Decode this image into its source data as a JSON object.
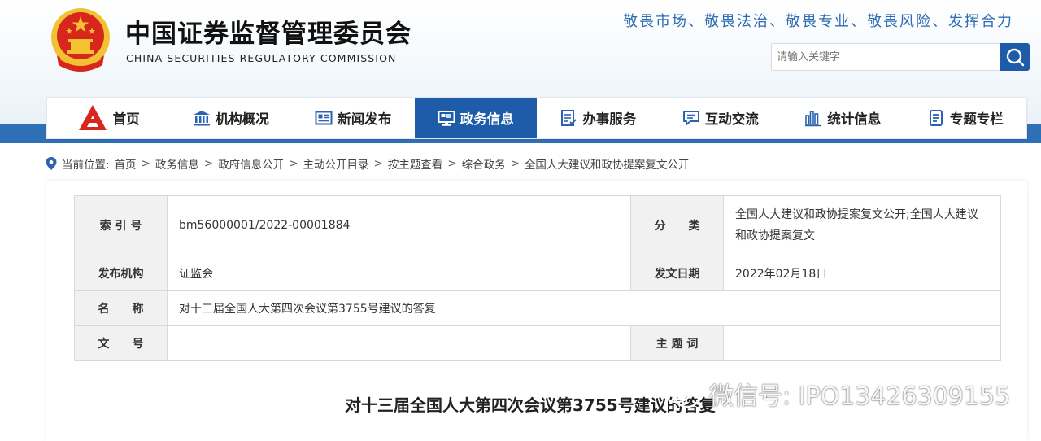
{
  "header": {
    "title_cn": "中国证券监督管理委员会",
    "title_en": "CHINA SECURITIES REGULATORY COMMISSION",
    "slogan": "敬畏市场、敬畏法治、敬畏专业、敬畏风险、发挥合力",
    "search_placeholder": "请输入关键字",
    "emblem_icon": "national-emblem-icon",
    "search_icon": "search-icon"
  },
  "nav": {
    "items": [
      {
        "label": "首页",
        "icon": "home-logo-icon",
        "active": false
      },
      {
        "label": "机构概况",
        "icon": "building-icon",
        "active": false
      },
      {
        "label": "新闻发布",
        "icon": "newspaper-icon",
        "active": false
      },
      {
        "label": "政务信息",
        "icon": "monitor-icon",
        "active": true
      },
      {
        "label": "办事服务",
        "icon": "checklist-icon",
        "active": false
      },
      {
        "label": "互动交流",
        "icon": "chat-icon",
        "active": false
      },
      {
        "label": "统计信息",
        "icon": "bar-chart-icon",
        "active": false
      },
      {
        "label": "专题专栏",
        "icon": "document-icon",
        "active": false
      }
    ]
  },
  "breadcrumb": {
    "prefix": "当前位置:",
    "items": [
      "首页",
      "政务信息",
      "政府信息公开",
      "主动公开目录",
      "按主题查看",
      "综合政务",
      "全国人大建议和政协提案复文公开"
    ]
  },
  "meta": {
    "index_label": "索 引 号",
    "index_value": "bm56000001/2022-00001884",
    "category_label": "分　　类",
    "category_value": "全国人大建议和政协提案复文公开;全国人大建议和政协提案复文",
    "publisher_label": "发布机构",
    "publisher_value": "证监会",
    "date_label": "发文日期",
    "date_value": "2022年02月18日",
    "name_label": "名　　称",
    "name_value": "对十三届全国人大第四次会议第3755号建议的答复",
    "docno_label": "文　　号",
    "docno_value": "",
    "keywords_label": "主 题 词",
    "keywords_value": ""
  },
  "document": {
    "title": "对十三届全国人大第四次会议第3755号建议的答复"
  },
  "watermark": {
    "text": "微信号: IPO13426309155",
    "icon": "wechat-icon"
  },
  "colors": {
    "brand_blue": "#1e5ba8",
    "band_blue": "#2f6fb6",
    "emblem_red": "#d7261c",
    "emblem_gold": "#f3c233"
  }
}
